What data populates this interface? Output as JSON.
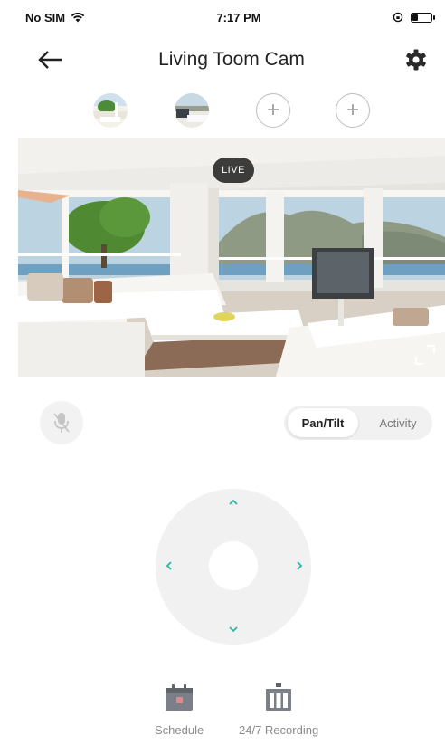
{
  "status_bar": {
    "carrier": "No SIM",
    "time": "7:17 PM",
    "battery_level": 0.3
  },
  "header": {
    "title": "Living Toom Cam"
  },
  "camera_switcher": {
    "add_symbol": "+"
  },
  "video": {
    "live_label": "LIVE"
  },
  "controls": {
    "mode_tabs": [
      "Pan/Tilt",
      "Activity"
    ],
    "selected_mode": "Pan/Tilt"
  },
  "bottom_tabs": [
    {
      "label": "Schedule",
      "icon": "calendar-icon"
    },
    {
      "label": "24/7 Recording",
      "icon": "recording-icon"
    }
  ],
  "colors": {
    "accent": "#2bb5a3",
    "control_bg": "#f1f1f1",
    "muted_text": "#8b8b8b"
  }
}
